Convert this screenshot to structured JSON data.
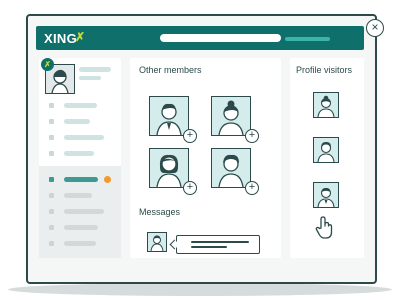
{
  "app": {
    "logo_text": "XING",
    "logo_mark": "✗"
  },
  "header": {
    "close_glyph": "×"
  },
  "main": {
    "members_title": "Other members",
    "messages_title": "Messages",
    "add_glyph": "+"
  },
  "visitors": {
    "title": "Profile visitors"
  },
  "colors": {
    "brand": "#0f6f6b",
    "accent": "#c8db36",
    "notification": "#f29a2e",
    "outline": "#2c4a4b",
    "card_fill": "#d5ecec"
  },
  "icons": [
    "xing-logo-icon",
    "close-icon",
    "person-icon",
    "add-contact-icon",
    "hand-cursor-icon",
    "notification-dot-icon"
  ]
}
